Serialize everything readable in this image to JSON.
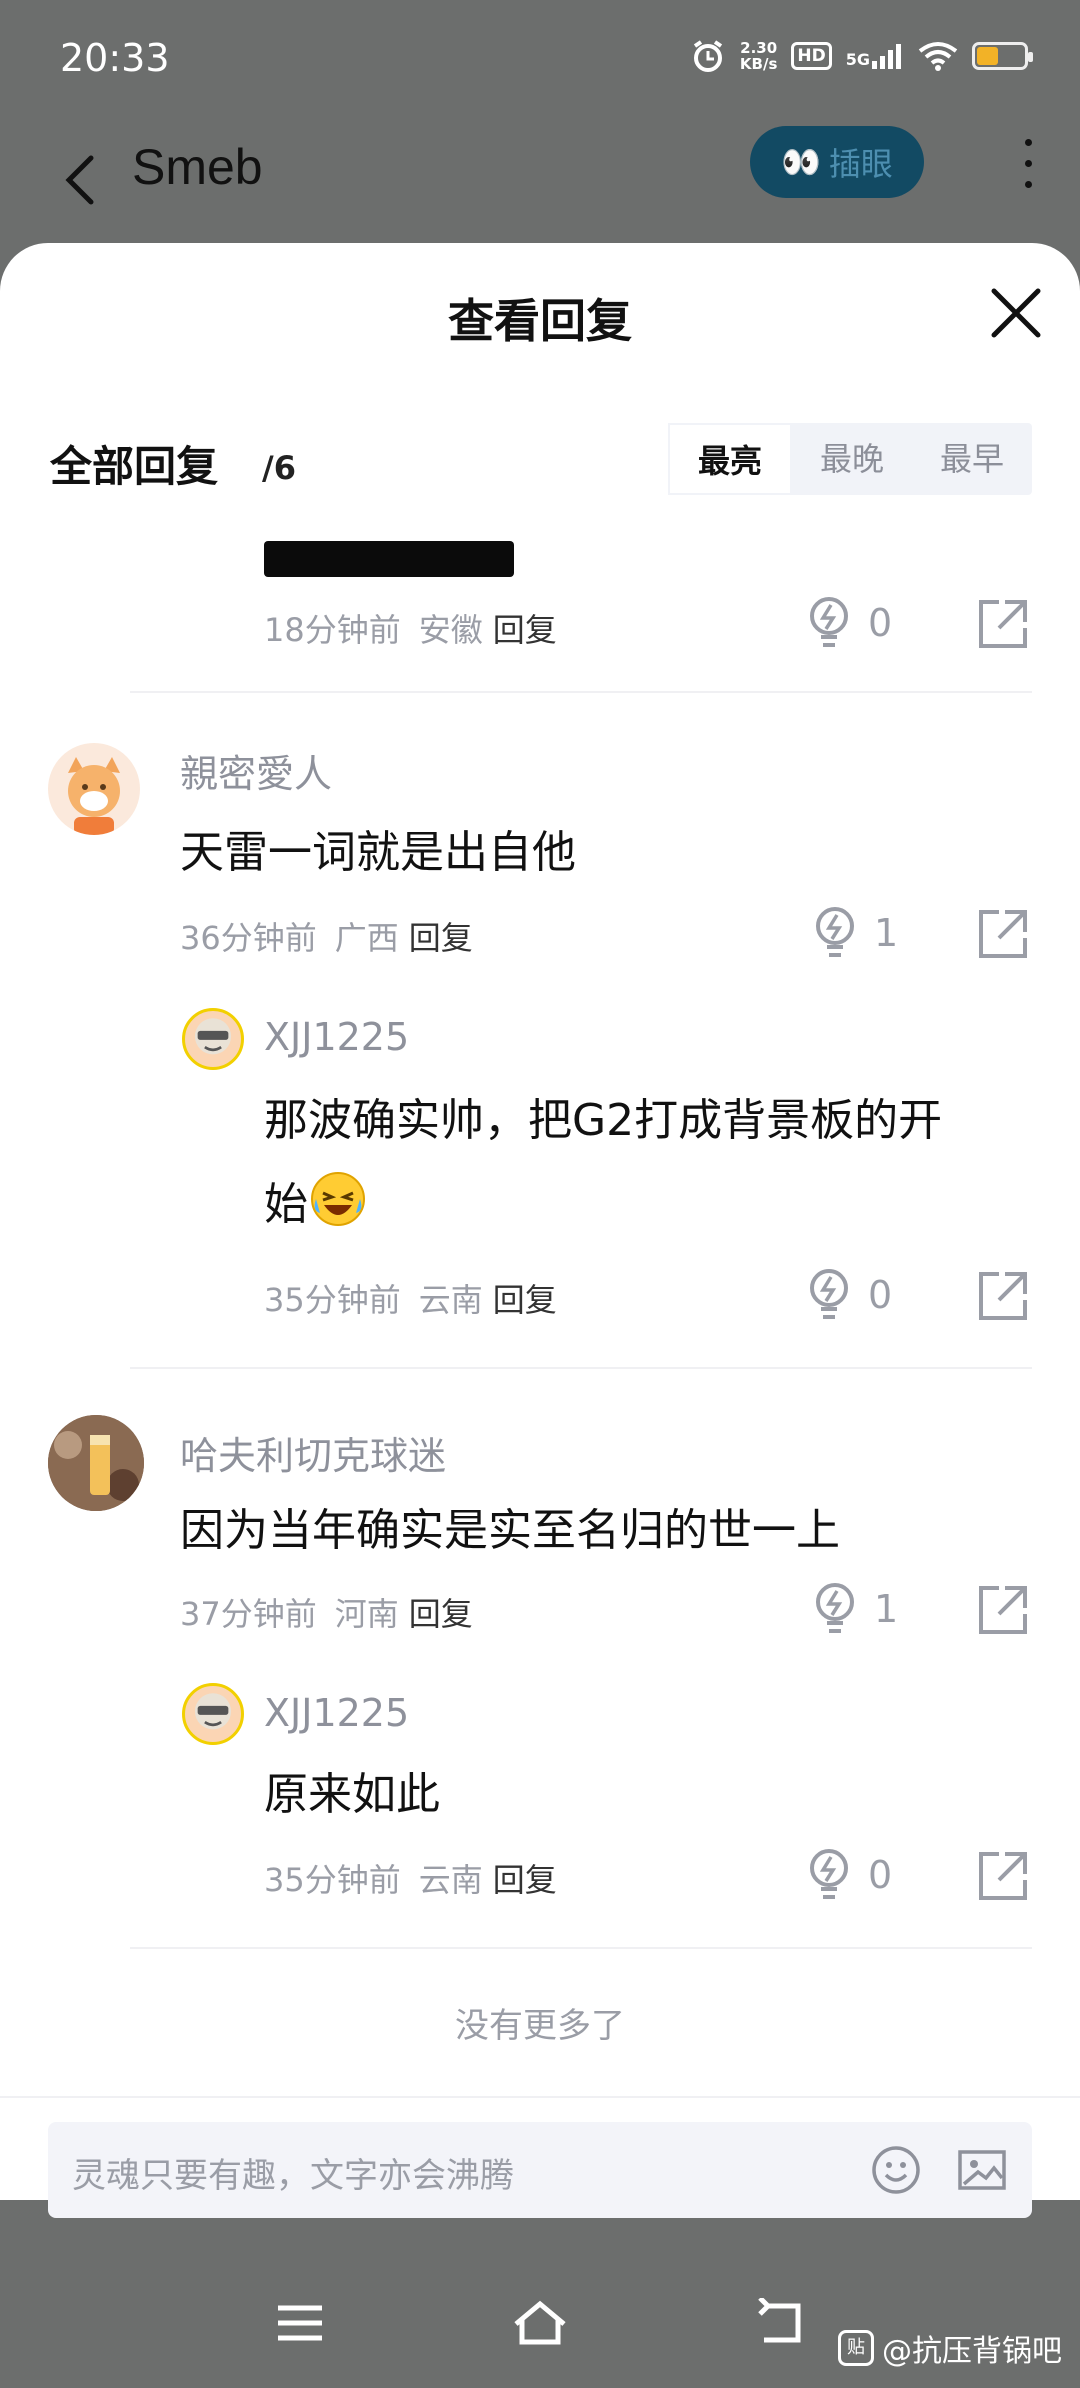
{
  "status_bar": {
    "time": "20:33",
    "net_speed_value": "2.30",
    "net_speed_unit": "KB/s",
    "hd": "HD",
    "network": "5G",
    "battery_level": 0.45
  },
  "header": {
    "title": "Smeb",
    "peek_label": "插眼",
    "peek_emoji": "👀"
  },
  "sheet": {
    "title": "查看回复",
    "all_replies_label": "全部回复",
    "reply_count": "/6",
    "sort_tabs": [
      "最亮",
      "最晚",
      "最早"
    ],
    "active_sort": "最亮"
  },
  "reply_label": "回复",
  "comments": [
    {
      "time": "18分钟前",
      "location": "安徽",
      "likes": "0"
    },
    {
      "user": "親密愛人",
      "text": "天雷一词就是出自他",
      "time": "36分钟前",
      "location": "广西",
      "likes": "1"
    },
    {
      "user": "XJJ1225",
      "text_line1": "那波确实帅，把G2打成背景板的开",
      "text_line2": "始",
      "time": "35分钟前",
      "location": "云南",
      "likes": "0"
    },
    {
      "user": "哈夫利切克球迷",
      "text": "因为当年确实是实至名归的世一上",
      "time": "37分钟前",
      "location": "河南",
      "likes": "1"
    },
    {
      "user": "XJJ1225",
      "text": "原来如此",
      "time": "35分钟前",
      "location": "云南",
      "likes": "0"
    }
  ],
  "no_more": "没有更多了",
  "input": {
    "placeholder": "灵魂只要有趣，文字亦会沸腾"
  },
  "watermark": {
    "logo": "贴",
    "text": "@抗压背锅吧"
  },
  "colors": {
    "overlay": "#6c6e6d",
    "peek_bg": "#124a63",
    "muted_text": "#9a9da6"
  }
}
